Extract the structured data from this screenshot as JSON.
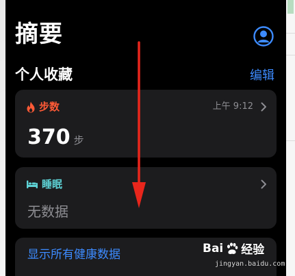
{
  "page": {
    "title": "摘要",
    "profile_icon": "person-circle-icon"
  },
  "favorites": {
    "section_title": "个人收藏",
    "edit_label": "编辑"
  },
  "cards": {
    "steps": {
      "icon": "flame-icon",
      "label": "步数",
      "time": "上午 9:12",
      "value": "370",
      "unit": "步",
      "color": "#ff5a36"
    },
    "sleep": {
      "icon": "bed-icon",
      "label": "睡眠",
      "value": "无数据",
      "color": "#5ed3d6"
    },
    "show_all": {
      "label": "显示所有健康数据"
    }
  },
  "overlay": {
    "annotation": "red-down-arrow"
  },
  "watermark": {
    "brand": "Bai",
    "brand_suffix": "经验",
    "url": "jingyan.baidu.com"
  },
  "colors": {
    "accent": "#3d8bff",
    "card_bg": "#1c1c1e",
    "secondary_text": "#8e8e93"
  }
}
